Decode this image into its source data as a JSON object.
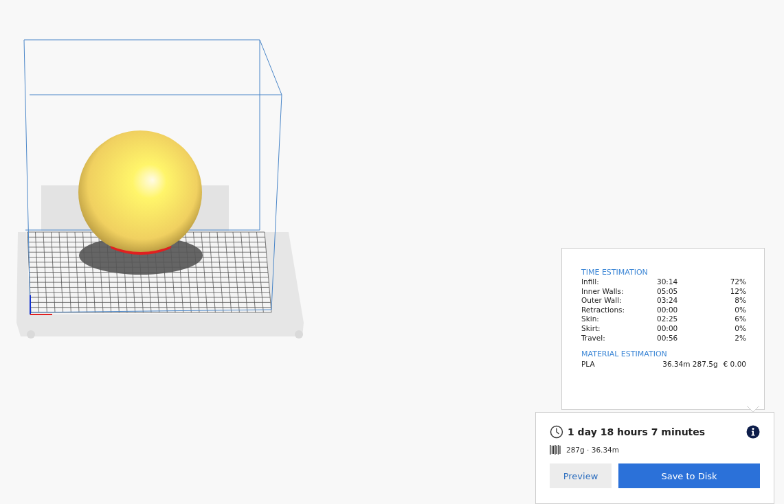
{
  "estimation_popup": {
    "time_heading": "TIME ESTIMATION",
    "time_rows": [
      {
        "label": "Infill:",
        "time": "30:14",
        "percent": "72%"
      },
      {
        "label": "Inner Walls:",
        "time": "05:05",
        "percent": "12%"
      },
      {
        "label": "Outer Wall:",
        "time": "03:24",
        "percent": "8%"
      },
      {
        "label": "Retractions:",
        "time": "00:00",
        "percent": "0%"
      },
      {
        "label": "Skin:",
        "time": "02:25",
        "percent": "6%"
      },
      {
        "label": "Skirt:",
        "time": "00:00",
        "percent": "0%"
      },
      {
        "label": "Travel:",
        "time": "00:56",
        "percent": "2%"
      }
    ],
    "material_heading": "MATERIAL ESTIMATION",
    "material_rows": [
      {
        "material": "PLA",
        "amount": "36.34m 287.5g",
        "cost": "€ 0.00"
      }
    ]
  },
  "print_card": {
    "duration": "1 day 18 hours 7 minutes",
    "material_summary": "287g · 36.34m",
    "buttons": [
      {
        "label": "Preview",
        "kind": "secondary"
      },
      {
        "label": "Save to Disk",
        "kind": "primary"
      }
    ]
  }
}
